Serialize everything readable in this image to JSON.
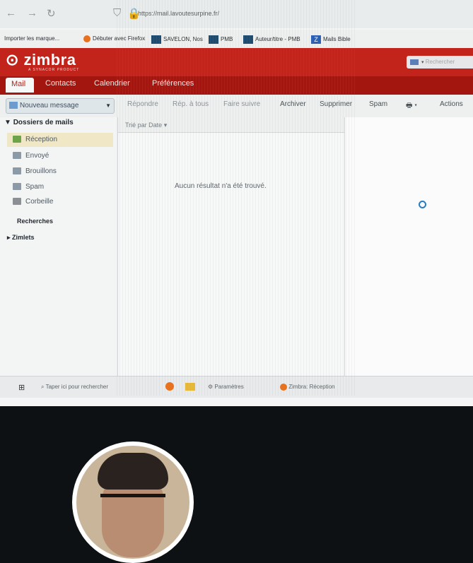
{
  "browser": {
    "url": "https://mail.lavoutesurpine.fr/",
    "bookmarks": [
      "Importer les marque...",
      "Débuter avec Firefox",
      "SAVELON, Nos",
      "PMB",
      "Auteur/titre - PMB",
      "Mails Bible"
    ]
  },
  "app": {
    "logo": "zimbra",
    "logo_sub": "A SYNACOR PRODUCT",
    "search_placeholder": "Rechercher"
  },
  "tabs": [
    "Mail",
    "Contacts",
    "Calendrier",
    "Préférences"
  ],
  "toolbar": {
    "new_message": "Nouveau message",
    "reply": "Répondre",
    "reply_all": "Rép. à tous",
    "forward": "Faire suivre",
    "archive": "Archiver",
    "delete": "Supprimer",
    "spam": "Spam",
    "actions": "Actions"
  },
  "sidebar": {
    "heading": "Dossiers de mails",
    "folders": [
      "Réception",
      "Envoyé",
      "Brouillons",
      "Spam",
      "Corbeille"
    ],
    "searches": "Recherches",
    "zimlets": "Zimlets"
  },
  "list": {
    "sort": "Trié par Date",
    "empty": "Aucun résultat n'a été trouvé."
  },
  "taskbar": {
    "search": "Taper ici pour rechercher",
    "settings": "Paramètres",
    "window": "Zimbra: Réception"
  }
}
